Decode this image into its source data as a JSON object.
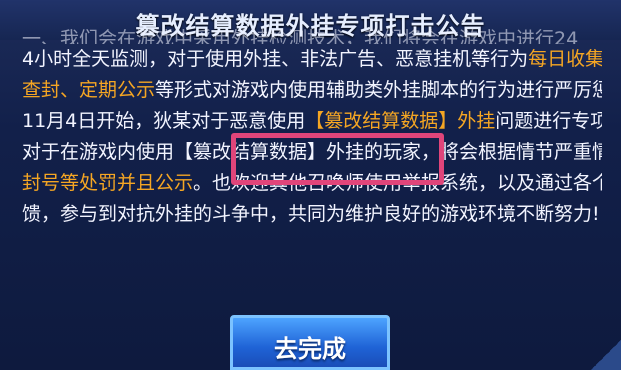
{
  "header": {
    "title": "篡改结算数据外挂专项打击公告"
  },
  "notice": {
    "lines": [
      {
        "parts": [
          {
            "t": "一、我们会在游戏中采用外挂检测技术，我们将会在游戏中进行24",
            "hl": false
          }
        ]
      },
      {
        "parts": [
          {
            "t": "4小时全天监测，对于使用外挂、非法广告、恶意挂机等行为",
            "hl": false
          },
          {
            "t": "每日收集、每日",
            "hl": true
          }
        ]
      },
      {
        "parts": [
          {
            "t": "查封、定期公示",
            "hl": true
          },
          {
            "t": "等形式对游戏内使用辅助类外挂脚本的行为进行严厉惩处!",
            "hl": false
          }
        ]
      },
      {
        "parts": [
          {
            "t": "11月4日开始，狄某对于恶意使用",
            "hl": false
          },
          {
            "t": "【篡改结算数据】外挂",
            "hl": true
          },
          {
            "t": "问题进行专项打击，",
            "hl": false
          }
        ]
      },
      {
        "parts": [
          {
            "t": "对于在游戏内使用【篡改结算数据】外挂的玩家，将会根据情节严重情况处以",
            "hl": false
          }
        ]
      },
      {
        "parts": [
          {
            "t": "封号等处罚并且公示",
            "hl": true
          },
          {
            "t": "。也欢迎其他召唤师使用举报系统，以及通过各个渠道反",
            "hl": false
          }
        ]
      },
      {
        "parts": [
          {
            "t": "馈，参与到对抗外挂的斗争中，共同为维护良好的游戏环境不断努力!",
            "hl": false
          }
        ]
      }
    ]
  },
  "actions": {
    "complete_label": "去完成"
  },
  "colors": {
    "highlight": "#f5a623",
    "callout_border": "#e0457a",
    "button": "#1f63d6"
  }
}
